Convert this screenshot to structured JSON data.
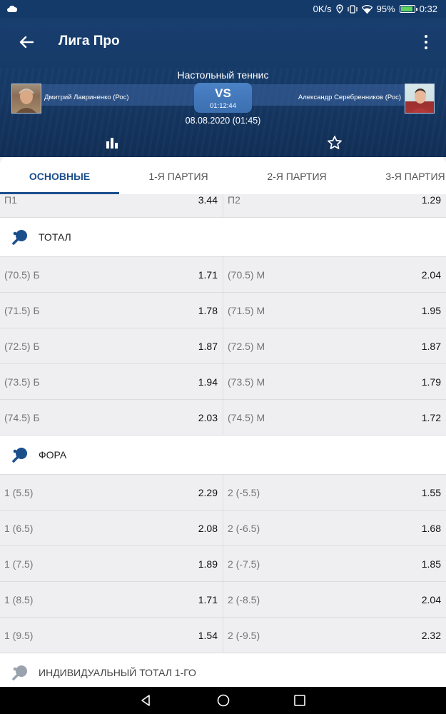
{
  "status_bar": {
    "speed": "0K/s",
    "battery": "95%",
    "battery_level": 0.95,
    "time": "0:32"
  },
  "header": {
    "title": "Лига Про",
    "sport": "Настольный теннис",
    "player1": "Дмитрий Лавриненко (Рос)",
    "player2": "Александр Серебренников (Рос)",
    "vs": "VS",
    "timer": "01:12:44",
    "datetime": "08.08.2020 (01:45)"
  },
  "tabs": [
    {
      "label": "ОСНОВНЫЕ",
      "active": true
    },
    {
      "label": "1-Я ПАРТИЯ",
      "active": false
    },
    {
      "label": "2-Я ПАРТИЯ",
      "active": false
    },
    {
      "label": "3-Я ПАРТИЯ",
      "active": false
    }
  ],
  "top_row": {
    "left_label": "П1",
    "left_odd": "3.44",
    "right_label": "П2",
    "right_odd": "1.29"
  },
  "sections": [
    {
      "title": "ТОТАЛ",
      "rows": [
        {
          "left_label": "(70.5) Б",
          "left_odd": "1.71",
          "right_label": "(70.5) М",
          "right_odd": "2.04"
        },
        {
          "left_label": "(71.5) Б",
          "left_odd": "1.78",
          "right_label": "(71.5) М",
          "right_odd": "1.95"
        },
        {
          "left_label": "(72.5) Б",
          "left_odd": "1.87",
          "right_label": "(72.5) М",
          "right_odd": "1.87"
        },
        {
          "left_label": "(73.5) Б",
          "left_odd": "1.94",
          "right_label": "(73.5) М",
          "right_odd": "1.79"
        },
        {
          "left_label": "(74.5) Б",
          "left_odd": "2.03",
          "right_label": "(74.5) М",
          "right_odd": "1.72"
        }
      ]
    },
    {
      "title": "ФОРА",
      "rows": [
        {
          "left_label": "1 (5.5)",
          "left_odd": "2.29",
          "right_label": "2 (-5.5)",
          "right_odd": "1.55"
        },
        {
          "left_label": "1 (6.5)",
          "left_odd": "2.08",
          "right_label": "2 (-6.5)",
          "right_odd": "1.68"
        },
        {
          "left_label": "1 (7.5)",
          "left_odd": "1.89",
          "right_label": "2 (-7.5)",
          "right_odd": "1.85"
        },
        {
          "left_label": "1 (8.5)",
          "left_odd": "1.71",
          "right_label": "2 (-8.5)",
          "right_odd": "2.04"
        },
        {
          "left_label": "1 (9.5)",
          "left_odd": "1.54",
          "right_label": "2 (-9.5)",
          "right_odd": "2.32"
        }
      ]
    },
    {
      "title": "ИНДИВИДУАЛЬНЫЙ ТОТАЛ 1-ГО",
      "rows": []
    }
  ],
  "colors": {
    "header_bg": "#163a67",
    "accent": "#1b4f8c",
    "vs_bg": "#3b6fb0",
    "section_icon": "#1b4f8c"
  },
  "icons": [
    "cloud-icon",
    "location-icon",
    "vibrate-icon",
    "wifi-icon",
    "battery-icon",
    "back-arrow-icon",
    "more-vert-icon",
    "statistics-icon",
    "star-outline-icon",
    "table-tennis-icon",
    "nav-back-icon",
    "nav-home-icon",
    "nav-recents-icon"
  ]
}
